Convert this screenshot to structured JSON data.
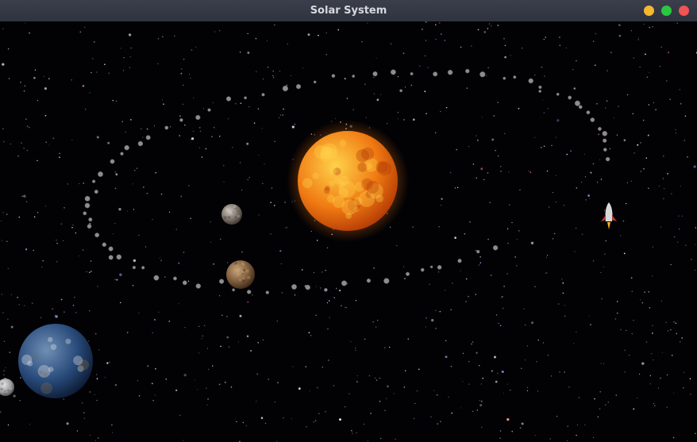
{
  "window": {
    "title": "Solar System",
    "controls": [
      {
        "name": "minimize",
        "color": "#f5b82e"
      },
      {
        "name": "maximize",
        "color": "#2ac840"
      },
      {
        "name": "close",
        "color": "#f25353"
      }
    ]
  },
  "scene": {
    "background": "#020205",
    "bodies": [
      {
        "name": "sun",
        "colors": [
          "#ffd24a",
          "#f07a12",
          "#b33a05"
        ]
      },
      {
        "name": "planet-small-gray",
        "colors": [
          "#cfc8c0",
          "#7a7068",
          "#3a342e"
        ]
      },
      {
        "name": "planet-brown",
        "colors": [
          "#c9a57a",
          "#7b5a3a",
          "#3a2616"
        ]
      },
      {
        "name": "planet-earth",
        "colors": [
          "#6f8fb5",
          "#284a7a",
          "#0c1a33"
        ]
      },
      {
        "name": "moon",
        "colors": [
          "#e6e6e6",
          "#a0a0a0",
          "#4a4a4a"
        ]
      }
    ],
    "rocket": {
      "name": "rocket",
      "body_color": "#d8d8d8",
      "fin_color": "#c0392b",
      "flame_color": "#ffb020"
    }
  }
}
